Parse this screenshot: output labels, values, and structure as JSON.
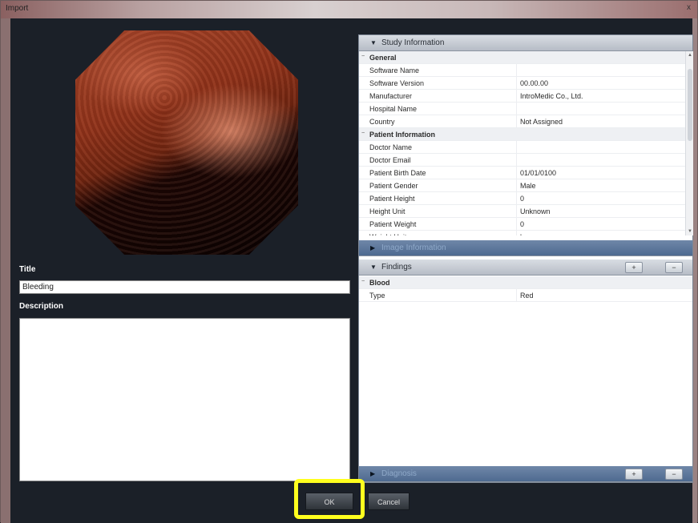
{
  "window": {
    "title": "Import",
    "close_glyph": "x"
  },
  "image": {
    "alt": "capsule endoscopy frame"
  },
  "form": {
    "title_label": "Title",
    "title_value": "Bleeding",
    "description_label": "Description",
    "description_value": ""
  },
  "study": {
    "header": "Study Information",
    "categories": [
      {
        "name": "General",
        "rows": [
          {
            "key": "Software Name",
            "value": ""
          },
          {
            "key": "Software Version",
            "value": "00.00.00"
          },
          {
            "key": "Manufacturer",
            "value": "IntroMedic Co., Ltd."
          },
          {
            "key": "Hospital Name",
            "value": ""
          },
          {
            "key": "Country",
            "value": "Not Assigned"
          }
        ]
      },
      {
        "name": "Patient Information",
        "rows": [
          {
            "key": "Doctor Name",
            "value": ""
          },
          {
            "key": "Doctor Email",
            "value": ""
          },
          {
            "key": "Patient Birth Date",
            "value": "01/01/0100"
          },
          {
            "key": "Patient Gender",
            "value": "Male"
          },
          {
            "key": "Patient Height",
            "value": "0"
          },
          {
            "key": "Height Unit",
            "value": "Unknown"
          },
          {
            "key": "Patient Weight",
            "value": "0"
          },
          {
            "key": "Weight Unit",
            "value": "kg"
          }
        ]
      }
    ]
  },
  "image_info": {
    "header": "Image Information"
  },
  "findings": {
    "header": "Findings",
    "add_glyph": "+",
    "remove_glyph": "−",
    "category": "Blood",
    "rows": [
      {
        "key": "Type",
        "value": "Red"
      }
    ]
  },
  "diagnosis": {
    "header": "Diagnosis",
    "add_glyph": "+",
    "remove_glyph": "−"
  },
  "buttons": {
    "ok": "OK",
    "cancel": "Cancel"
  },
  "colors": {
    "highlight": "#ffff1e",
    "panel_header_dark": "#4e6a90"
  }
}
